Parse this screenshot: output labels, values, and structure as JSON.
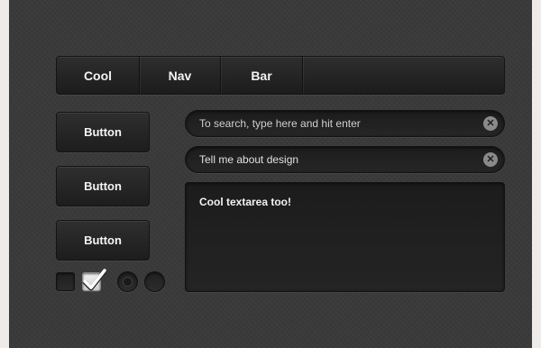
{
  "nav": {
    "items": [
      {
        "label": "Cool"
      },
      {
        "label": "Nav"
      },
      {
        "label": "Bar"
      }
    ]
  },
  "buttons": [
    {
      "label": "Button"
    },
    {
      "label": "Button"
    },
    {
      "label": "Button"
    }
  ],
  "controls": {
    "checkbox_1": {
      "checked": false
    },
    "checkbox_2": {
      "checked": true
    },
    "radio_1": {
      "selected": true
    },
    "radio_2": {
      "selected": false
    }
  },
  "search": {
    "placeholder": "To search, type here and hit enter",
    "clear_icon": "close-circle-icon"
  },
  "about": {
    "value": "Tell me about design",
    "clear_icon": "close-circle-icon"
  },
  "textarea": {
    "value": "Cool textarea too!"
  },
  "colors": {
    "background": "#3a3a3a",
    "surface": "#262626",
    "text": "#f2f2f2"
  }
}
